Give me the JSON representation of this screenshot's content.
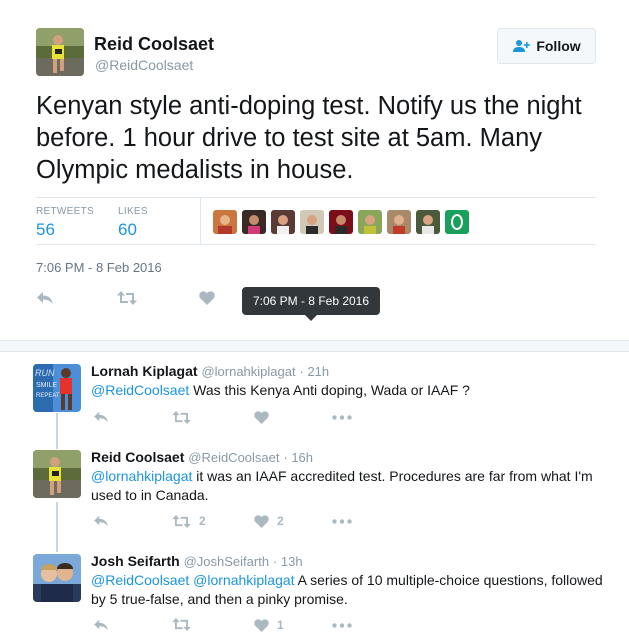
{
  "tweet": {
    "author_name": "Reid Coolsaet",
    "author_handle": "@ReidCoolsaet",
    "follow_label": "Follow",
    "text": "Kenyan style anti-doping test. Notify us the night before. 1 hour drive to test site at 5am. Many Olympic medalists in house.",
    "retweets_label": "RETWEETS",
    "retweets_count": "56",
    "likes_label": "LIKES",
    "likes_count": "60",
    "timestamp": "7:06 PM - 8 Feb 2016",
    "tooltip": "7:06 PM - 8 Feb 2016"
  },
  "replies": [
    {
      "name": "Lornah Kiplagat",
      "handle": "@lornahkiplagat",
      "time": "· 21h",
      "mention": "@ReidCoolsaet",
      "text": " Was this Kenya Anti doping, Wada or IAAF ?",
      "retweets": "",
      "likes": ""
    },
    {
      "name": "Reid Coolsaet",
      "handle": "@ReidCoolsaet",
      "time": "· 16h",
      "mention": "@lornahkiplagat",
      "text": " it was an IAAF accredited test. Procedures are far from what I'm used to in Canada.",
      "retweets": "2",
      "likes": "2"
    },
    {
      "name": "Josh Seifarth",
      "handle": "@JoshSeifarth",
      "time": "· 13h",
      "mention": "@ReidCoolsaet @lornahkiplagat",
      "text": " A series of 10 multiple-choice questions, followed by 5 true-false, and then a pinky promise.",
      "retweets": "",
      "likes": "1"
    }
  ],
  "icons": {
    "reply": "reply-icon",
    "retweet": "retweet-icon",
    "like": "heart-icon",
    "more": "more-icon",
    "follow": "add-user-icon"
  },
  "colors": {
    "link": "#1b95e0",
    "muted": "#8899a6",
    "icon": "#aab8c2",
    "tooltip_bg": "#32373c"
  }
}
